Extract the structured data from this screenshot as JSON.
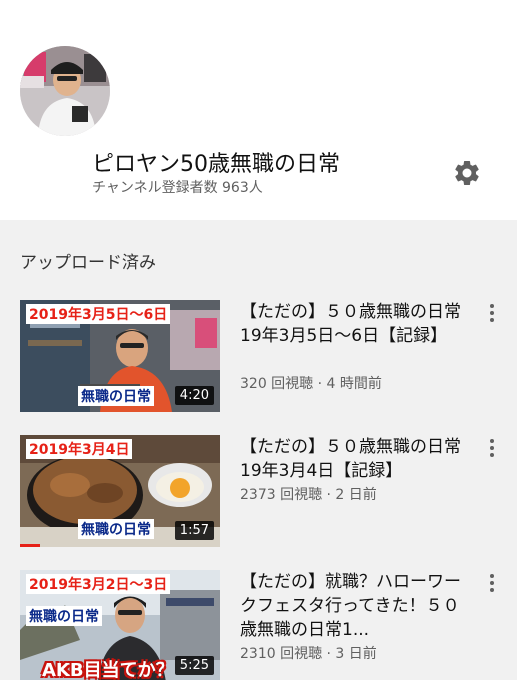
{
  "channel": {
    "name": "ピロヤン50歳無職の日常",
    "subscribers": "チャンネル登録者数 963人"
  },
  "section": {
    "title": "アップロード済み"
  },
  "videos": [
    {
      "title": "【ただの】５０歳無職の日常19年3月5日〜6日【記録】",
      "meta": "320 回視聴 · 4 時間前",
      "duration": "4:20",
      "thumb_date": "2019年3月5日〜6日",
      "thumb_caption": "無職の日常"
    },
    {
      "title": "【ただの】５０歳無職の日常19年3月4日【記録】",
      "meta": "2373 回視聴 · 2 日前",
      "duration": "1:57",
      "thumb_date": "2019年3月4日",
      "thumb_caption": "無職の日常",
      "watched_fraction": 0.1
    },
    {
      "title": "【ただの】就職？ハローワークフェスタ行ってきた！５０歳無職の日常1...",
      "meta": "2310 回視聴 · 3 日前",
      "duration": "5:25",
      "thumb_date": "2019年3月2日〜3日",
      "thumb_caption": "無職の日常",
      "thumb_caption2": "AKB目当てか？"
    }
  ],
  "icons": {
    "settings": "gear-icon",
    "menu": "more-vert-icon"
  },
  "colors": {
    "accent": "#e62117",
    "secondary_text": "#606060",
    "background": "#f1f1f1"
  }
}
